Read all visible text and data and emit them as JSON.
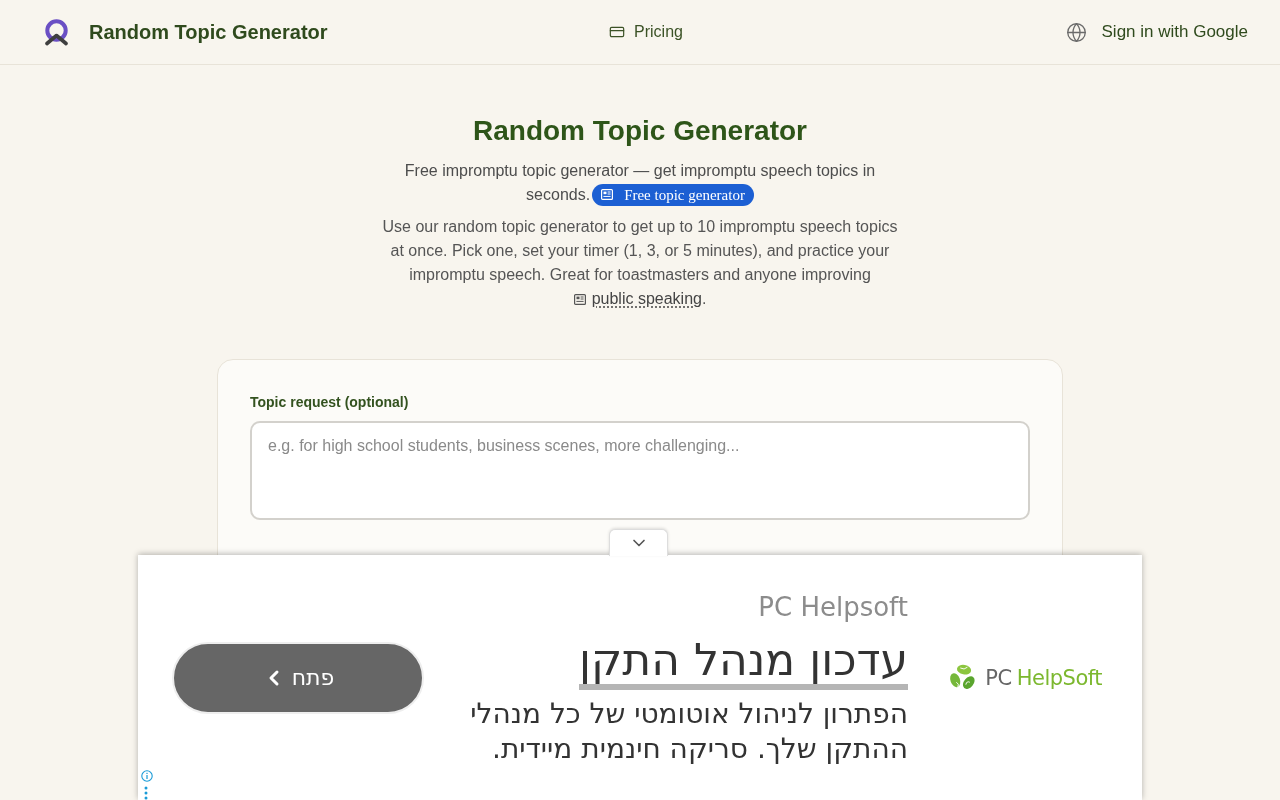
{
  "header": {
    "brand": "Random Topic Generator",
    "nav": [
      {
        "label": "Pricing"
      }
    ],
    "sign_in": {
      "label": "Sign in with Google"
    }
  },
  "hero": {
    "title": "Random Topic Generator",
    "subtitle": "Free impromptu topic generator — get impromptu speech topics in seconds.",
    "badge": "Free topic generator",
    "intro": "Use our random topic generator to get up to 10 impromptu speech topics at once. Pick one, set your timer (1, 3, or 5 minutes), and practice your impromptu speech. Great for toastmasters and anyone improving",
    "intro_link": "public speaking",
    "intro_end": "."
  },
  "form": {
    "topic_request": {
      "label": "Topic request (optional)",
      "placeholder": "e.g. for high school students, business scenes, more challenging..."
    }
  },
  "ad": {
    "advertiser": "PC Helpsoft",
    "headline": "עדכון מנהל התקן",
    "body": "הפתרון לניהול אוטומטי של כל מנהלי ההתקן שלך. סריקה חינמית מיידית.",
    "cta": "פתח",
    "logo_words": [
      "PC",
      "HelpSoft"
    ]
  }
}
